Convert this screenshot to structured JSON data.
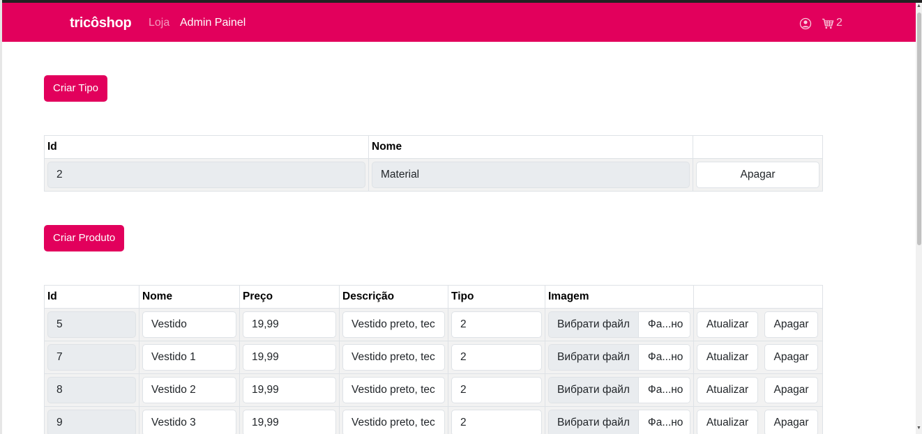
{
  "navbar": {
    "brand": "tricôshop",
    "links": [
      {
        "label": "Loja"
      },
      {
        "label": "Admin Painel"
      }
    ],
    "cart_count": "2"
  },
  "tipos": {
    "create_button": "Criar Tipo",
    "headers": {
      "id": "Id",
      "nome": "Nome",
      "actions": ""
    },
    "rows": [
      {
        "id": "2",
        "nome": "Material",
        "delete_label": "Apagar"
      }
    ]
  },
  "produtos": {
    "create_button": "Criar Produto",
    "headers": {
      "id": "Id",
      "nome": "Nome",
      "preco": "Preço",
      "descricao": "Descrição",
      "tipo": "Tipo",
      "imagem": "Imagem",
      "actions": ""
    },
    "rows": [
      {
        "id": "5",
        "nome": "Vestido",
        "preco": "19,99",
        "descricao": "Vestido preto, tec",
        "tipo": "2",
        "file_button": "Вибрати файл",
        "file_name": "Фа...но",
        "update_label": "Atualizar",
        "delete_label": "Apagar"
      },
      {
        "id": "7",
        "nome": "Vestido 1",
        "preco": "19,99",
        "descricao": "Vestido preto, tec",
        "tipo": "2",
        "file_button": "Вибрати файл",
        "file_name": "Фа...но",
        "update_label": "Atualizar",
        "delete_label": "Apagar"
      },
      {
        "id": "8",
        "nome": "Vestido 2",
        "preco": "19,99",
        "descricao": "Vestido preto, tec",
        "tipo": "2",
        "file_button": "Вибрати файл",
        "file_name": "Фа...но",
        "update_label": "Atualizar",
        "delete_label": "Apagar"
      },
      {
        "id": "9",
        "nome": "Vestido 3",
        "preco": "19,99",
        "descricao": "Vestido preto, tec",
        "tipo": "2",
        "file_button": "Вибрати файл",
        "file_name": "Фа...но",
        "update_label": "Atualizar",
        "delete_label": "Apagar"
      }
    ]
  },
  "colors": {
    "brand": "#e2005c",
    "readonly_bg": "#e9ecef",
    "row_bg": "#f2f2f2"
  },
  "icons": {
    "user": "user-circle-icon",
    "cart": "cart-icon"
  }
}
